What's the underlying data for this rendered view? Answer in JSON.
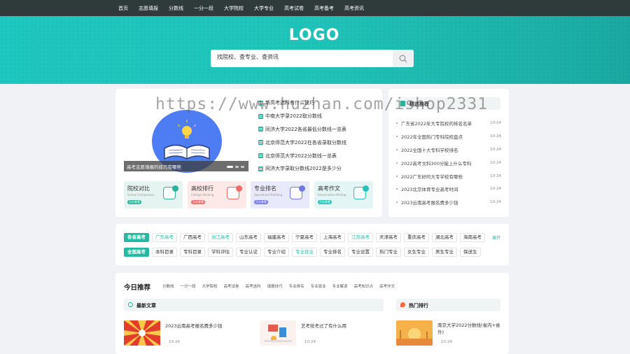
{
  "nav": {
    "items": [
      "首页",
      "志愿填报",
      "分数线",
      "一分一段",
      "大学院校",
      "大学专业",
      "高考试卷",
      "高考备考",
      "高考资讯"
    ]
  },
  "hero": {
    "logo": "LOGO",
    "search_placeholder": "找院校、查专业、查资讯"
  },
  "watermark": "https://www.huzhan.com/ishop2331",
  "slider": {
    "caption": "高考志愿填报的技巧有哪些"
  },
  "news": [
    "新高考选科有什么技巧",
    "中南大学录2022取分数线",
    "同济大学2022各省最低分数线一览表",
    "北京师范大学2022在各省录取分数线",
    "北京师范大学2022分数线一览表",
    "同济大学录取分数线2022是多少分"
  ],
  "tiles": [
    {
      "title": "院校对比",
      "sub": "School Comparison",
      "btn": "点击查看",
      "bg": "#e5f4f1",
      "accent": "#2ab39a",
      "dot": "#2ab39a"
    },
    {
      "title": "高校排行",
      "sub": "College Ranking",
      "btn": "点击查看",
      "bg": "#fde9e8",
      "accent": "#ef6a67",
      "dot": "#ef6a67"
    },
    {
      "title": "专业排名",
      "sub": "Specialized Ranking",
      "btn": "点击查看",
      "bg": "#e8e9fb",
      "accent": "#6f79e6",
      "dot": "#6f79e6"
    },
    {
      "title": "高考作文",
      "sub": "Examination Writing",
      "btn": "点击查看",
      "bg": "#e3f5f4",
      "accent": "#28c0b8",
      "dot": "#28c0b8"
    }
  ],
  "ranking": {
    "title": "精选推荐",
    "items": [
      {
        "text": "广东省2022年大专院校的排名名单",
        "date": "10-24"
      },
      {
        "text": "2022年全国热门专科院校盘点",
        "date": "10-24"
      },
      {
        "text": "2022全国十大专科学校排名",
        "date": "10-24"
      },
      {
        "text": "2022高考文科300分能上什么专科",
        "date": "10-24"
      },
      {
        "text": "2022广东好的大专学校有哪些",
        "date": "10-24"
      },
      {
        "text": "2023北京体育专业高考时间",
        "date": "10-24"
      },
      {
        "text": "2023云南高考报名费多少钱",
        "date": "10-24"
      }
    ]
  },
  "region_tags": [
    {
      "label": "各省高考",
      "type": "main"
    },
    {
      "label": "广东高考",
      "type": "hl"
    },
    {
      "label": "广西高考",
      "type": ""
    },
    {
      "label": "浙江高考",
      "type": "hl"
    },
    {
      "label": "山东高考",
      "type": ""
    },
    {
      "label": "福建高考",
      "type": ""
    },
    {
      "label": "宁夏高考",
      "type": ""
    },
    {
      "label": "上海高考",
      "type": ""
    },
    {
      "label": "江苏高考",
      "type": "hl"
    },
    {
      "label": "天津高考",
      "type": ""
    },
    {
      "label": "重庆高考",
      "type": ""
    },
    {
      "label": "湖北高考",
      "type": ""
    },
    {
      "label": "海南高考",
      "type": ""
    }
  ],
  "more_label": "展开",
  "topic_tags": [
    {
      "label": "全国高考",
      "type": "main"
    },
    {
      "label": "本科目录",
      "type": ""
    },
    {
      "label": "专科目录",
      "type": ""
    },
    {
      "label": "学科评估",
      "type": ""
    },
    {
      "label": "专业认证",
      "type": ""
    },
    {
      "label": "专业介绍",
      "type": ""
    },
    {
      "label": "专业就业",
      "type": "hl"
    },
    {
      "label": "专业排名",
      "type": ""
    },
    {
      "label": "专业设置",
      "type": ""
    },
    {
      "label": "热门专业",
      "type": ""
    },
    {
      "label": "女生专业",
      "type": ""
    },
    {
      "label": "男生专业",
      "type": ""
    },
    {
      "label": "保送生",
      "type": ""
    }
  ],
  "recommend": {
    "title": "今日推荐",
    "tabs": [
      "分数线",
      "一分一段",
      "大学院校",
      "高考试卷",
      "高考选科",
      "填报技巧",
      "专业排名",
      "专业就业",
      "专业解读",
      "高考知识点",
      "高考作文"
    ]
  },
  "latest": {
    "title": "最新文章"
  },
  "hot": {
    "title": "热门排行"
  },
  "articles": [
    {
      "title": "2023云南高考报名费多少钱",
      "date": "10-24"
    },
    {
      "title": "艺考统考过了有什么用",
      "date": "10-24"
    },
    {
      "title": "南京大学2022分数线(省内+省外)",
      "date": "10-24"
    }
  ]
}
